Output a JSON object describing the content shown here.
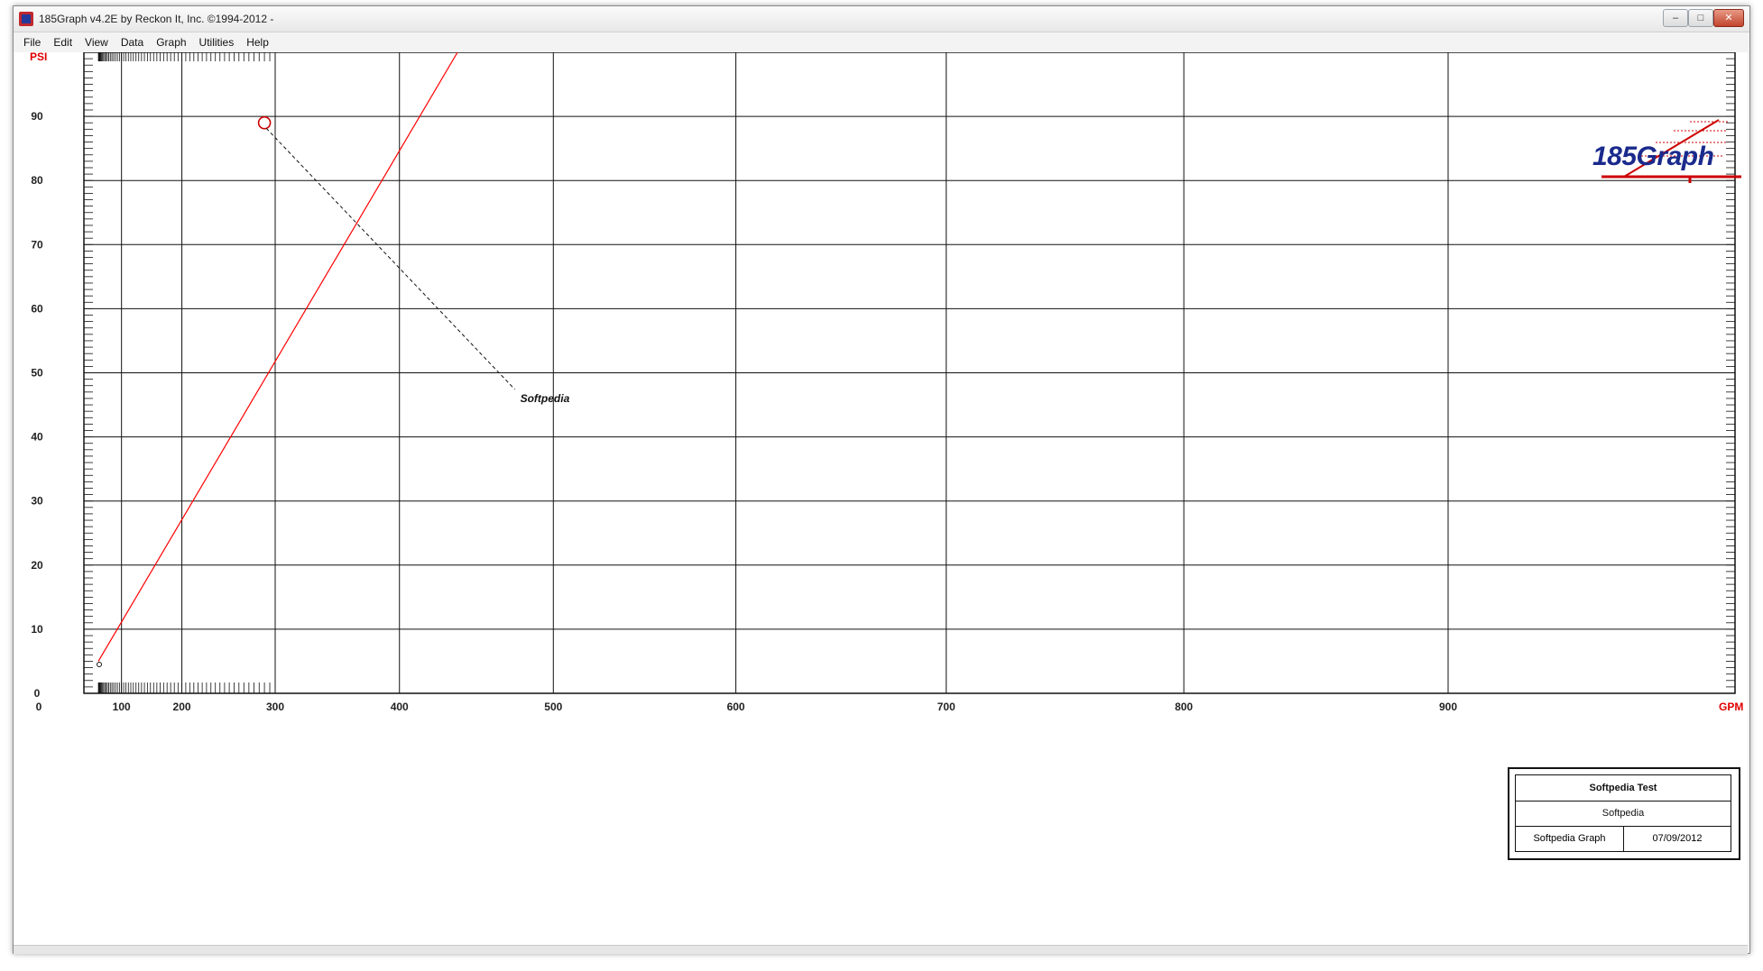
{
  "window": {
    "title": "185Graph v4.2E by Reckon It, Inc. ©1994-2012 -",
    "controls": {
      "minimize": "–",
      "maximize": "□",
      "close": "✕"
    }
  },
  "menu": [
    "File",
    "Edit",
    "View",
    "Data",
    "Graph",
    "Utilities",
    "Help"
  ],
  "logo": {
    "text": "185Graph",
    "colors": {
      "text": "#1a2a8c",
      "accent": "#cc0000"
    }
  },
  "legend": {
    "title": "Softpedia Test",
    "subtitle": "Softpedia",
    "left_cell": "Softpedia Graph",
    "right_cell": "07/09/2012"
  },
  "chart_data": {
    "type": "line",
    "scale": "n1.85 hydrant flow-test paper (x axis non-linear)",
    "xlabel": "GPM",
    "ylabel": "PSI",
    "x_tick_labels": [
      "0",
      "100",
      "200",
      "300",
      "400",
      "500",
      "600",
      "700",
      "800",
      "900"
    ],
    "y_tick_labels": [
      "0",
      "10",
      "20",
      "30",
      "40",
      "50",
      "60",
      "70",
      "80",
      "90"
    ],
    "ylim": [
      0,
      100
    ],
    "grid": true,
    "series": [
      {
        "color": "#ff0000",
        "points": [
          [
            0,
            5
          ],
          [
            440,
            100
          ]
        ]
      }
    ],
    "marker": {
      "x": 290,
      "y": 89,
      "shape": "circle",
      "color": "#cc0000"
    },
    "annotation": {
      "text": "Softpedia",
      "x": 480,
      "y": 46,
      "leader": "dashed"
    },
    "start_marker": {
      "x": 0,
      "y": 4.5
    }
  }
}
